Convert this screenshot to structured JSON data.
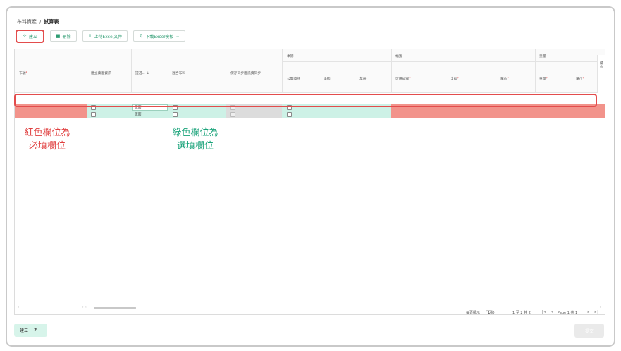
{
  "breadcrumb": {
    "parent": "布料資產",
    "sep": "/",
    "current": "試算表"
  },
  "toolbar": {
    "create": "建立",
    "delete": "刪除",
    "upload": "上傳Excel文件",
    "download": "下載Excel模板"
  },
  "icons": {
    "create": "sparkle-icon",
    "delete": "trash-icon",
    "upload": "upload-icon",
    "download": "download-icon",
    "chevron": "chevron-down-icon"
  },
  "columns": {
    "name": "布號",
    "build_db": "建立藥園資訊",
    "supply": "提選...",
    "mixed": "混合布料",
    "sync": "保存同步圖訊資同步",
    "group_season": "季節",
    "public": "公開資訊",
    "season": "季節",
    "year": "年份",
    "group_width": "幅寬",
    "usable_width": "可用幅寬",
    "full_width": "全幅",
    "unit": "單位",
    "group_weight": "重量",
    "weight": "重量",
    "weight_unit": "單位",
    "side_panel": "欄位"
  },
  "rows": [
    {
      "supply_value": "正面"
    },
    {
      "supply_value": "正面"
    }
  ],
  "annotations": {
    "required": "紅色欄位為\n必填欄位",
    "optional": "綠色欄位為\n選填欄位"
  },
  "pager": {
    "per_page_label": "每頁顯示",
    "per_page_value": "100",
    "range": "1 至 2 共 2",
    "page": "Page 1 共 1"
  },
  "status": {
    "label": "建立",
    "count": "2"
  },
  "submit": "提交",
  "colors": {
    "accent": "#2e9c72",
    "required": "#f2938b",
    "optional": "#cdf1e6",
    "highlight": "#e34c4c"
  }
}
